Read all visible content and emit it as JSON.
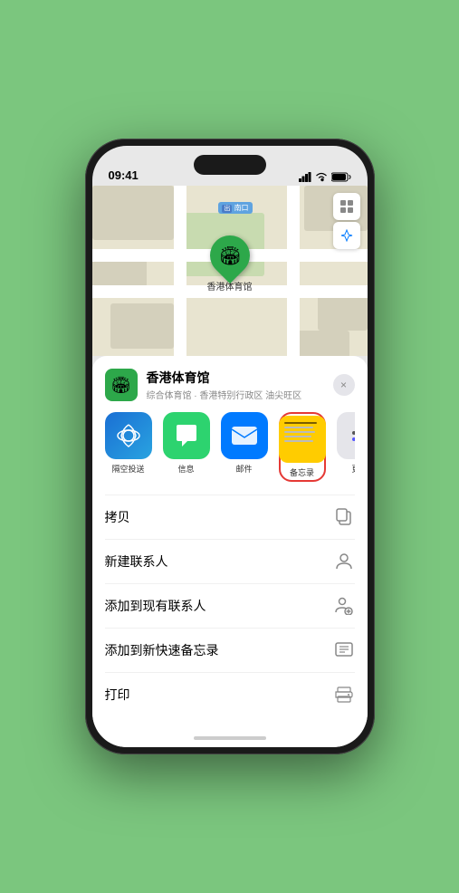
{
  "status_bar": {
    "time": "09:41",
    "location_arrow": true
  },
  "map": {
    "road_label": "南口",
    "road_label_prefix": "出"
  },
  "venue": {
    "name": "香港体育馆",
    "subtitle": "综合体育馆 · 香港特别行政区 油尖旺区",
    "pin_label": "香港体育馆"
  },
  "apps": [
    {
      "id": "airdrop",
      "label": "隔空投送"
    },
    {
      "id": "messages",
      "label": "信息"
    },
    {
      "id": "mail",
      "label": "邮件"
    },
    {
      "id": "notes",
      "label": "备忘录"
    },
    {
      "id": "more",
      "label": "更多"
    }
  ],
  "actions": [
    {
      "id": "copy",
      "label": "拷贝",
      "icon": "copy"
    },
    {
      "id": "new-contact",
      "label": "新建联系人",
      "icon": "person"
    },
    {
      "id": "add-existing",
      "label": "添加到现有联系人",
      "icon": "person-add"
    },
    {
      "id": "quick-note",
      "label": "添加到新快速备忘录",
      "icon": "note"
    },
    {
      "id": "print",
      "label": "打印",
      "icon": "print"
    }
  ],
  "close_label": "×"
}
